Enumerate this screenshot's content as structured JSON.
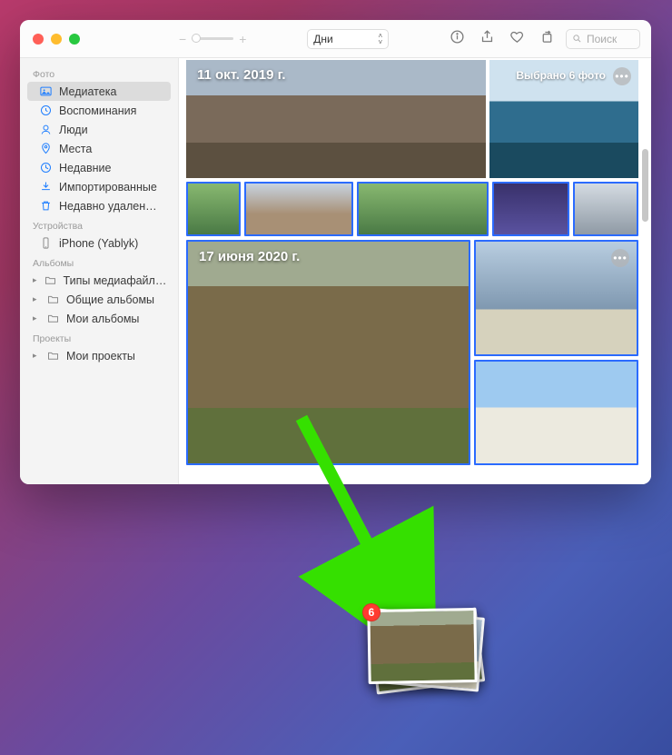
{
  "toolbar": {
    "view_select": "Дни",
    "search_placeholder": "Поиск"
  },
  "sidebar": {
    "sections": [
      {
        "title": "Фото",
        "items": [
          {
            "label": "Медиатека"
          },
          {
            "label": "Воспоминания"
          },
          {
            "label": "Люди"
          },
          {
            "label": "Места"
          },
          {
            "label": "Недавние"
          },
          {
            "label": "Импортированные"
          },
          {
            "label": "Недавно удален…"
          }
        ]
      },
      {
        "title": "Устройства",
        "items": [
          {
            "label": "iPhone (Yablyk)"
          }
        ]
      },
      {
        "title": "Альбомы",
        "items": [
          {
            "label": "Типы медиафайл…"
          },
          {
            "label": "Общие альбомы"
          },
          {
            "label": "Мои альбомы"
          }
        ]
      },
      {
        "title": "Проекты",
        "items": [
          {
            "label": "Мои проекты"
          }
        ]
      }
    ]
  },
  "content": {
    "group1": {
      "date": "11 окт. 2019 г.",
      "selection": "Выбрано 6 фото"
    },
    "group2": {
      "date": "17 июня 2020 г."
    }
  },
  "drag": {
    "count": "6"
  }
}
